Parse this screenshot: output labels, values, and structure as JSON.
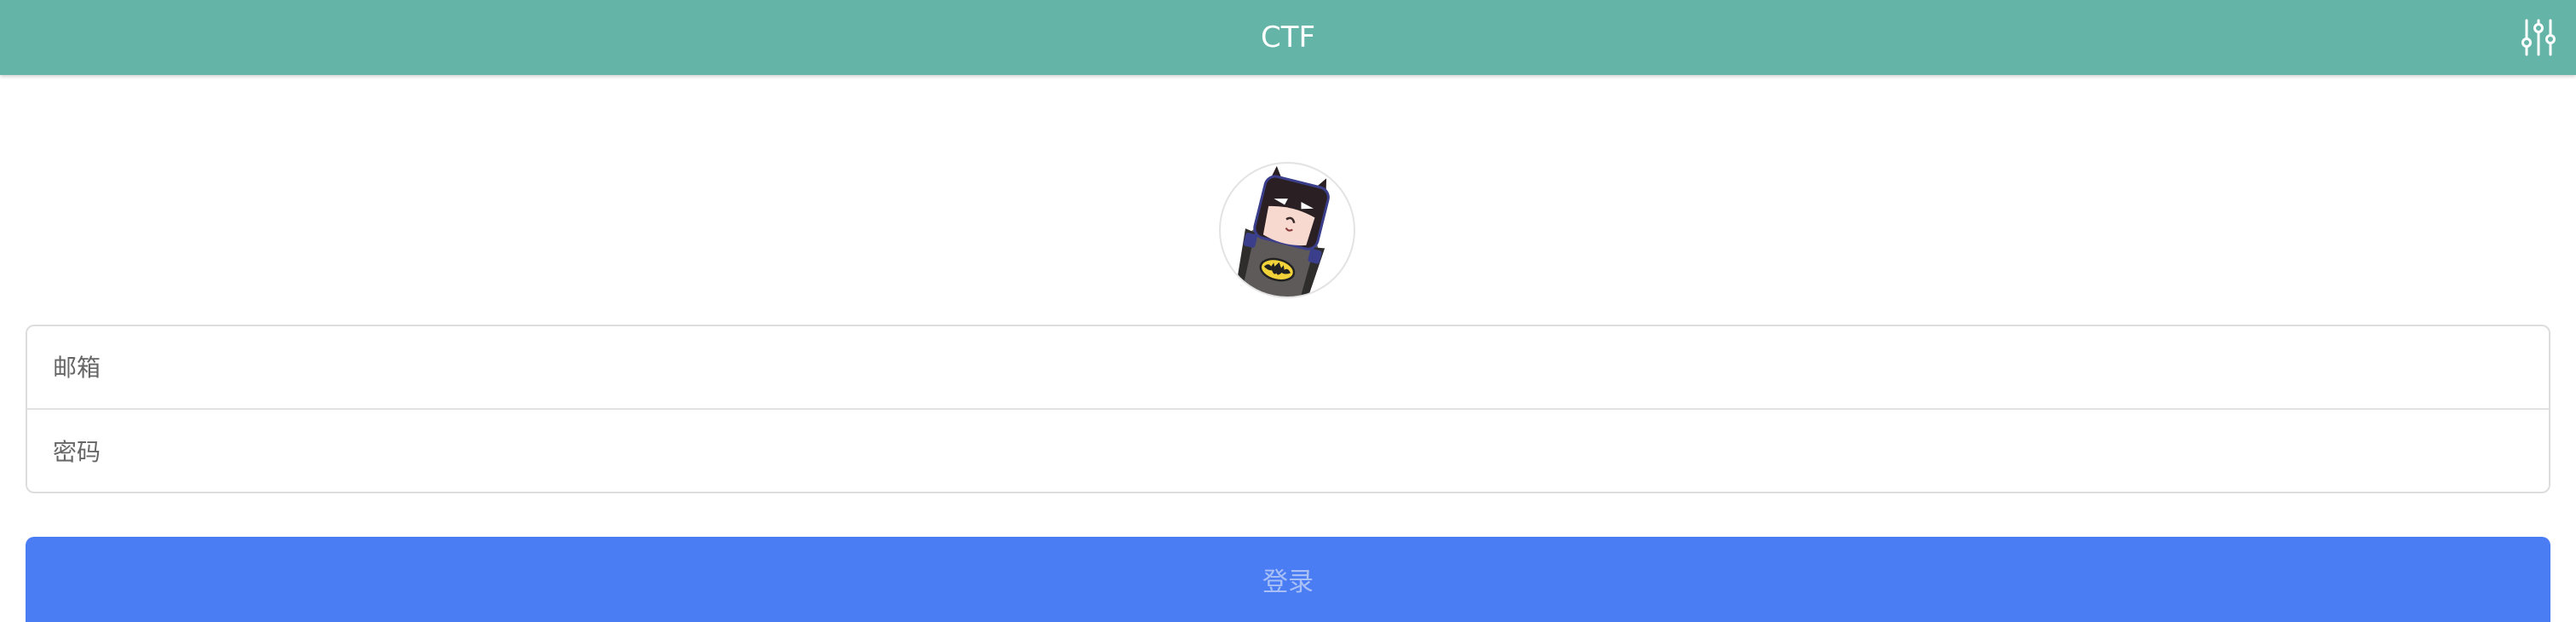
{
  "header": {
    "title": "CTF",
    "settings_icon": "sliders-icon"
  },
  "avatar": {
    "icon": "batman-avatar-icon"
  },
  "form": {
    "email_placeholder": "邮箱",
    "email_value": "",
    "password_placeholder": "密码",
    "password_value": ""
  },
  "login": {
    "label": "登录"
  },
  "colors": {
    "header_bg": "#64b4a8",
    "button_bg": "#4a7cf3",
    "button_text": "#a9c0f7"
  }
}
